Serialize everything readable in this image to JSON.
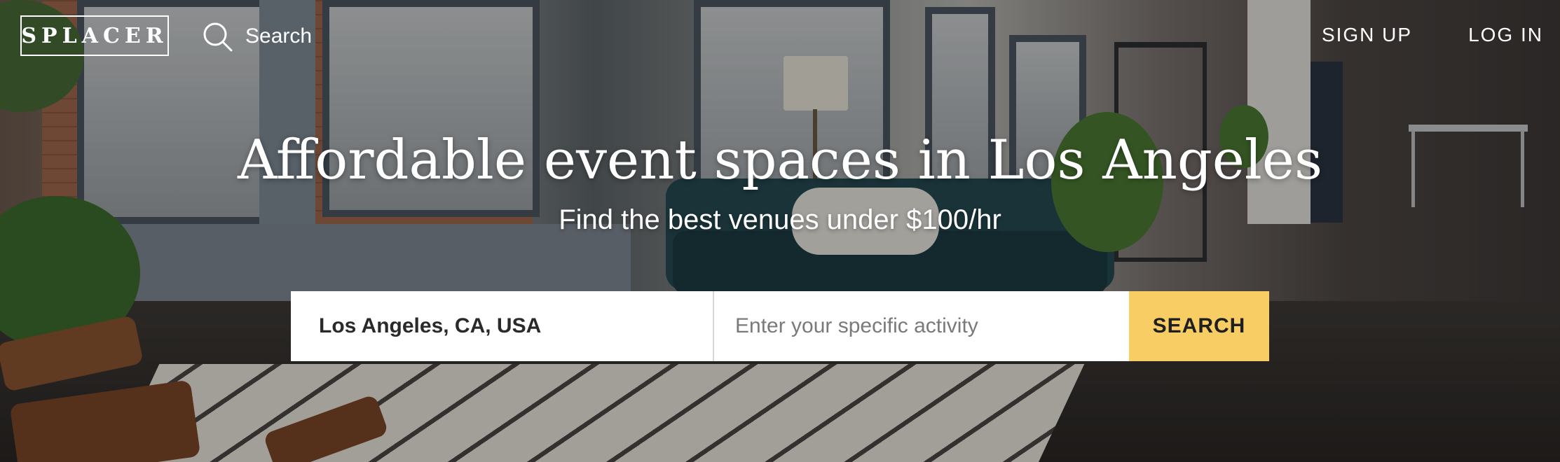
{
  "header": {
    "logo_text": "SPLACER",
    "search_label": "Search",
    "nav": {
      "sign_up": "SIGN UP",
      "log_in": "LOG IN"
    }
  },
  "hero": {
    "headline": "Affordable event spaces in Los Angeles",
    "subheadline": "Find the best venues under $100/hr"
  },
  "search_form": {
    "location_value": "Los Angeles, CA, USA",
    "activity_placeholder": "Enter your specific activity",
    "button_label": "SEARCH"
  },
  "colors": {
    "search_button": "#f8ce64",
    "text_on_hero": "#ffffff"
  },
  "icons": {
    "search": "magnifier-icon"
  }
}
